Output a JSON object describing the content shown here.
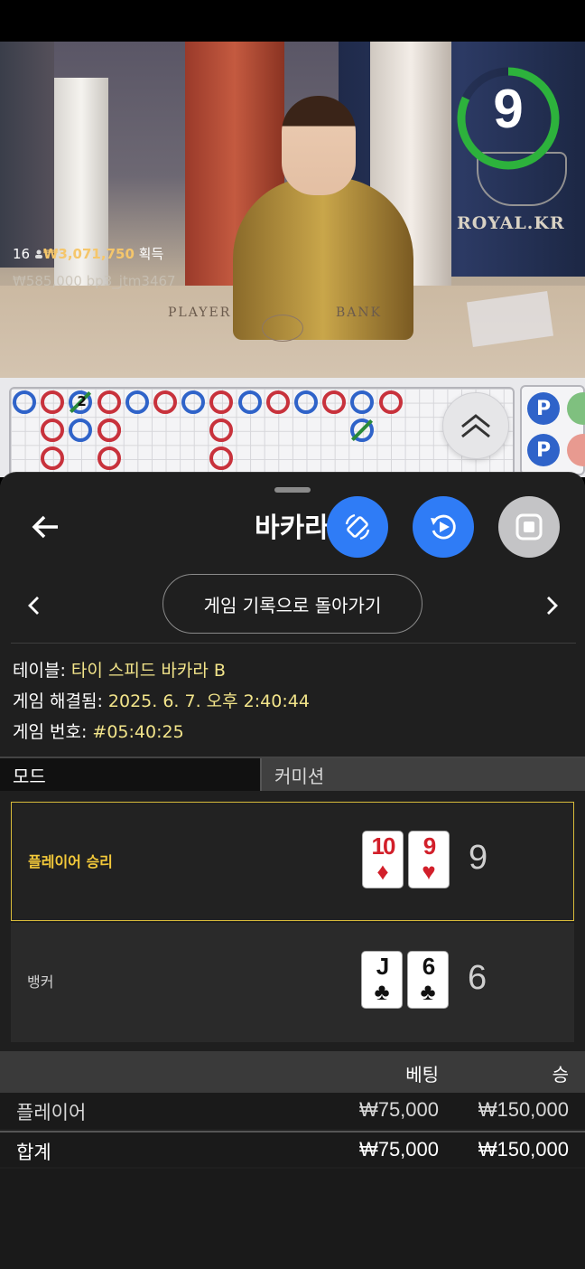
{
  "video": {
    "overlay": {
      "count": "16",
      "user_icon": "person-icon",
      "win_amount": "₩3,071,750",
      "win_suffix": "획득",
      "bet_amount": "₩585,000",
      "username": "bp3_jtm3467"
    },
    "timer_value": "9",
    "timer_fraction": 0.82,
    "timer_color": "#2db23c",
    "brand": "ROYAL.KR",
    "table_print_left": "PLAYER",
    "table_print_right": "BANK"
  },
  "roadmap": {
    "tie_count_label": "2",
    "expand_icon": "double-chevron-up-icon",
    "side_badge_1": "P",
    "side_badge_2": "P"
  },
  "sheet": {
    "title": "바카라",
    "back_icon": "arrow-left-icon",
    "buttons": [
      {
        "name": "rotate-screen",
        "icon": "rotate-icon",
        "color": "#2f7cf6"
      },
      {
        "name": "replay",
        "icon": "replay-icon",
        "color": "#2f7cf6"
      },
      {
        "name": "stop",
        "icon": "stop-icon",
        "color": "#c4c4c6"
      }
    ],
    "nav": {
      "prev_icon": "chevron-left-icon",
      "next_icon": "chevron-right-icon",
      "back_to_history": "게임 기록으로 돌아가기"
    },
    "meta": {
      "table_label": "테이블:",
      "table_value": "타이 스피드 바카라 B",
      "resolved_label": "게임 해결됨:",
      "resolved_value": "2025. 6. 7. 오후 2:40:44",
      "game_no_label": "게임 번호:",
      "game_no_value": "#05:40:25"
    },
    "tabs": {
      "mode": "모드",
      "commission": "커미션"
    },
    "results": {
      "player": {
        "label": "플레이어 승리",
        "cards": [
          {
            "rank": "10",
            "suit": "♦"
          },
          {
            "rank": "9",
            "suit": "♥"
          }
        ],
        "score": "9"
      },
      "banker": {
        "label": "뱅커",
        "cards": [
          {
            "rank": "J",
            "suit": "♣"
          },
          {
            "rank": "6",
            "suit": "♣"
          }
        ],
        "score": "6"
      }
    },
    "bets": {
      "col_bet": "베팅",
      "col_win": "승",
      "rows": [
        {
          "label": "플레이어",
          "bet": "₩75,000",
          "win": "₩150,000"
        }
      ],
      "total": {
        "label": "합계",
        "bet": "₩75,000",
        "win": "₩150,000"
      }
    }
  }
}
